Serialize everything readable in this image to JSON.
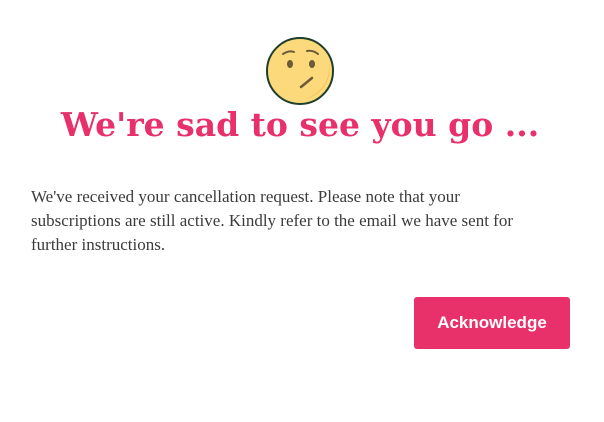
{
  "dialog": {
    "icon": "confused-face-icon",
    "title": "We're sad to see you go ...",
    "message": "We've received your cancellation request. Please note that your subscriptions are still active. Kindly refer to the email we have sent for further instructions.",
    "acknowledge_label": "Acknowledge"
  },
  "colors": {
    "accent": "#e8306b",
    "text": "#3b3b3b",
    "emoji_fill": "#fcd97a",
    "emoji_outline": "#1e3d2a",
    "background": "#ffffff"
  }
}
